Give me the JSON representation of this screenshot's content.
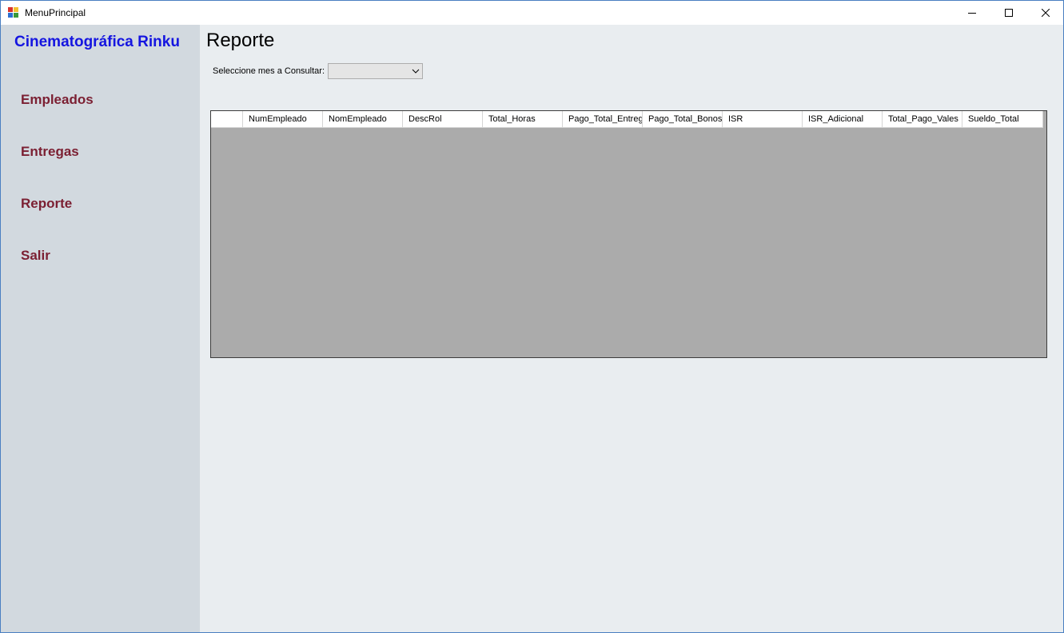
{
  "window": {
    "title": "MenuPrincipal"
  },
  "sidebar": {
    "brand": "Cinematográfica Rinku",
    "items": [
      {
        "label": "Empleados"
      },
      {
        "label": "Entregas"
      },
      {
        "label": "Reporte"
      },
      {
        "label": "Salir"
      }
    ]
  },
  "main": {
    "title": "Reporte",
    "filter_label": "Seleccione mes a Consultar:",
    "month_select_value": "",
    "grid": {
      "columns": [
        "NumEmpleado",
        "NomEmpleado",
        "DescRol",
        "Total_Horas",
        "Pago_Total_Entreg",
        "Pago_Total_Bonos",
        "ISR",
        "ISR_Adicional",
        "Total_Pago_Vales",
        "Sueldo_Total"
      ],
      "rows": []
    }
  },
  "icons": {
    "app": "app-icon",
    "minimize": "minimize-icon",
    "maximize": "maximize-icon",
    "close": "close-icon",
    "dropdown": "chevron-down-icon"
  },
  "colors": {
    "brand": "#1515e0",
    "nav_text": "#7b1f32",
    "sidebar_bg": "#d2d9df",
    "content_bg": "#e9edf0",
    "grid_bg": "#ababab",
    "window_border": "#4a7fc1"
  }
}
